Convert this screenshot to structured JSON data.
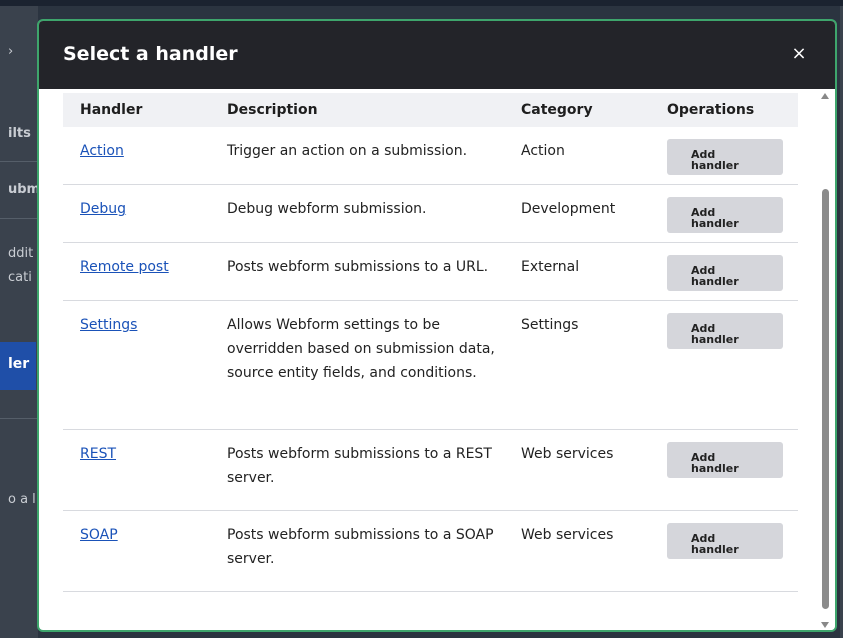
{
  "background": {
    "fragments": [
      "›",
      "ilts",
      "ubm",
      "ddit",
      "cati",
      "ler",
      "o a l"
    ]
  },
  "dialog": {
    "title": "Select a handler",
    "close_label": "×",
    "columns": [
      "Handler",
      "Description",
      "Category",
      "Operations"
    ],
    "rows": [
      {
        "handler": "Action",
        "description": "Trigger an action on a submission.",
        "category": "Action",
        "button": [
          "Add",
          "handler"
        ]
      },
      {
        "handler": "Debug",
        "description": "Debug webform submission.",
        "category": "Development",
        "button": [
          "Add",
          "handler"
        ]
      },
      {
        "handler": "Remote post",
        "description": "Posts webform submissions to a URL.",
        "category": "External",
        "button": [
          "Add",
          "handler"
        ]
      },
      {
        "handler": "Settings",
        "description": "Allows Webform settings to be overridden based on submission data, source entity fields, and conditions.",
        "category": "Settings",
        "button": [
          "Add",
          "handler"
        ]
      },
      {
        "handler": "REST",
        "description": "Posts webform submissions to a REST server.",
        "category": "Web services",
        "button": [
          "Add",
          "handler"
        ]
      },
      {
        "handler": "SOAP",
        "description": "Posts webform submissions to a SOAP server.",
        "category": "Web services",
        "button": [
          "Add",
          "handler"
        ]
      }
    ]
  },
  "colors": {
    "header_bg": "#232429",
    "border_accent": "#3ea56c",
    "link": "#1a52b8",
    "button_bg": "#d5d6db"
  }
}
